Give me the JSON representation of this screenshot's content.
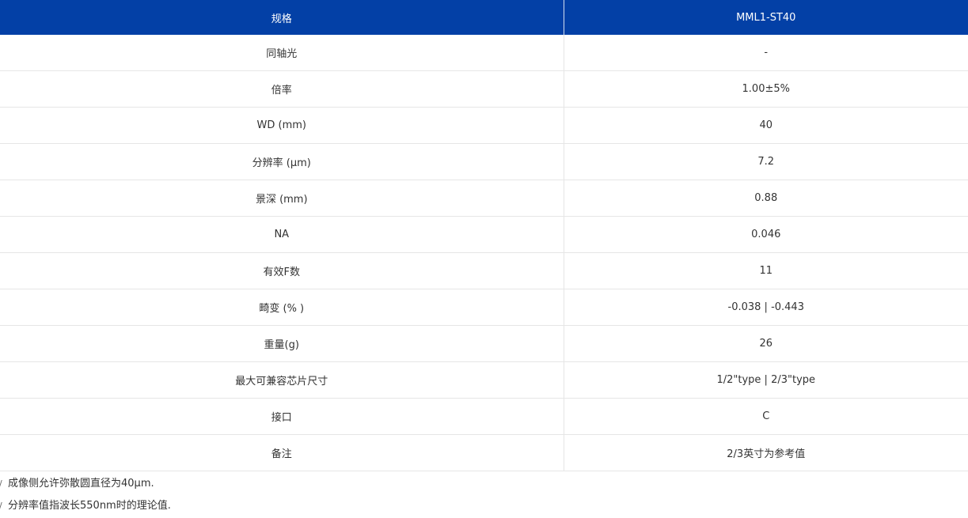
{
  "table": {
    "headers": [
      "规格",
      "MML1-ST40"
    ],
    "rows": [
      {
        "label": "同轴光",
        "value": "-"
      },
      {
        "label": "倍率",
        "value": "1.00±5%"
      },
      {
        "label": "WD (mm)",
        "value": "40"
      },
      {
        "label": "分辨率 (μm)",
        "value": "7.2"
      },
      {
        "label": "景深 (mm)",
        "value": "0.88"
      },
      {
        "label": "NA",
        "value": "0.046"
      },
      {
        "label": "有效F数",
        "value": "11"
      },
      {
        "label": "畸变 (% )",
        "value": "-0.038 | -0.443"
      },
      {
        "label": "重量(g)",
        "value": "26"
      },
      {
        "label": "最大可兼容芯片尺寸",
        "value": "1/2\"type | 2/3\"type"
      },
      {
        "label": "接口",
        "value": "C"
      },
      {
        "label": "备注",
        "value": "2/3英寸为参考值"
      }
    ]
  },
  "notes": [
    {
      "mark": "/",
      "text": "成像侧允许弥散圆直径为40μm."
    },
    {
      "mark": "/",
      "text": "分辨率值指波长550nm时的理论值."
    }
  ],
  "colors": {
    "header_bg": "#0340a6",
    "header_text": "#ffffff",
    "border": "#e6e6e6"
  }
}
